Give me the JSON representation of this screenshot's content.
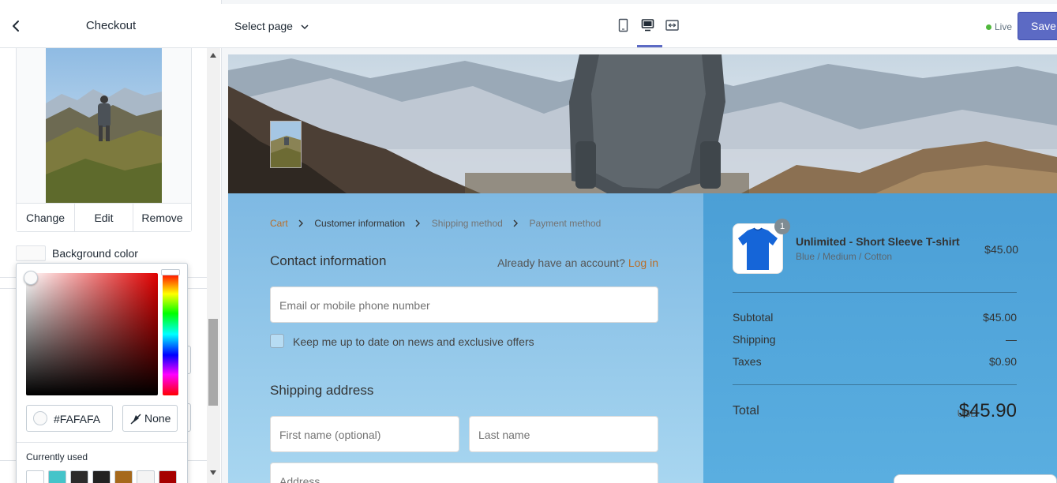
{
  "sidebar": {
    "title": "Checkout",
    "image_actions": {
      "change": "Change",
      "edit": "Edit",
      "remove": "Remove"
    },
    "background_color_label": "Background color",
    "background_color_value": "#FAFAFA"
  },
  "color_picker": {
    "hex_value": "#FAFAFA",
    "none_label": "None",
    "currently_used_label": "Currently used",
    "swatches": [
      "#ffffff",
      "#45c4c9",
      "#2b2b2b",
      "#222222",
      "#a6691c",
      "#f4f4f4",
      "#a60000"
    ]
  },
  "topbar": {
    "select_page": "Select page",
    "live_label": "Live",
    "save_label": "Save",
    "accent_color": "#5c6ac4"
  },
  "checkout": {
    "breadcrumbs": {
      "cart": "Cart",
      "customer_info": "Customer information",
      "shipping": "Shipping method",
      "payment": "Payment method"
    },
    "contact_title": "Contact information",
    "account_prompt": "Already have an account?",
    "login_link": "Log in",
    "email_placeholder": "Email or mobile phone number",
    "newsletter_label": "Keep me up to date on news and exclusive offers",
    "shipping_title": "Shipping address",
    "first_name_placeholder": "First name (optional)",
    "last_name_placeholder": "Last name",
    "address_placeholder": "Address"
  },
  "summary": {
    "product_name": "Unlimited - Short Sleeve T-shirt",
    "product_variant": "Blue / Medium / Cotton",
    "product_price": "$45.00",
    "quantity_badge": "1",
    "subtotal_label": "Subtotal",
    "subtotal_value": "$45.00",
    "shipping_label": "Shipping",
    "shipping_value": "—",
    "taxes_label": "Taxes",
    "taxes_value": "$0.90",
    "total_label": "Total",
    "currency": "USD",
    "total_value": "$45.90"
  }
}
